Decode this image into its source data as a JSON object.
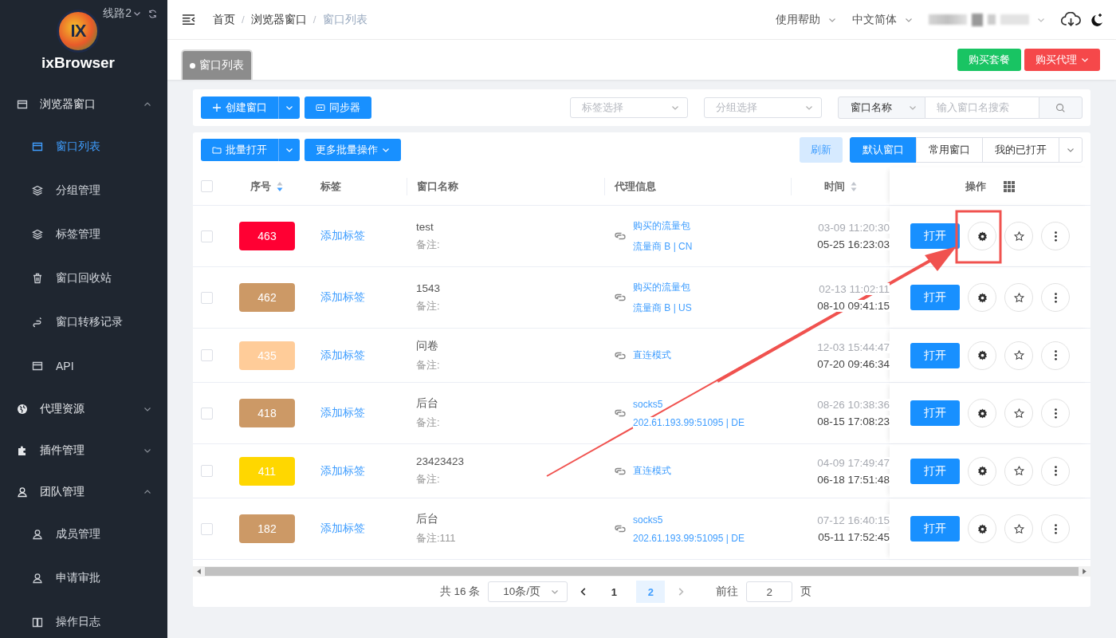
{
  "sidebar": {
    "route": "线路2",
    "logo_mark": "IX",
    "brand": "ixBrowser",
    "menu": [
      {
        "label": "浏览器窗口",
        "expanded": true,
        "children": [
          {
            "label": "窗口列表",
            "selected": true
          },
          {
            "label": "分组管理",
            "selected": false
          },
          {
            "label": "标签管理",
            "selected": false
          },
          {
            "label": "窗口回收站",
            "selected": false
          },
          {
            "label": "窗口转移记录",
            "selected": false
          },
          {
            "label": "API",
            "selected": false
          }
        ]
      },
      {
        "label": "代理资源",
        "expanded": false
      },
      {
        "label": "插件管理",
        "expanded": false
      },
      {
        "label": "团队管理",
        "expanded": true,
        "children": [
          {
            "label": "成员管理",
            "selected": false
          },
          {
            "label": "申请审批",
            "selected": false
          },
          {
            "label": "操作日志",
            "selected": false
          }
        ]
      }
    ]
  },
  "header": {
    "breadcrumb": [
      "首页",
      "浏览器窗口",
      "窗口列表"
    ],
    "separator": "/",
    "help": "使用帮助",
    "language": "中文简体"
  },
  "page_tabs": [
    {
      "label": "窗口列表",
      "selected": true
    }
  ],
  "top_buttons": {
    "buy_plan": "购买套餐",
    "buy_proxy": "购买代理"
  },
  "toolbar": {
    "create": "创建窗口",
    "sync": "同步器",
    "tag_select": {
      "placeholder": "标签选择"
    },
    "group_select": {
      "placeholder": "分组选择"
    },
    "search_type": "窗口名称",
    "search": {
      "placeholder": "输入窗口名搜索"
    }
  },
  "toolbar2": {
    "batch_open": "批量打开",
    "more_batch": "更多批量操作",
    "refresh": "刷新",
    "views": [
      {
        "label": "默认窗口",
        "selected": true
      },
      {
        "label": "常用窗口",
        "selected": false
      },
      {
        "label": "我的已打开",
        "selected": false
      }
    ]
  },
  "table": {
    "select_all": {
      "checked": false
    },
    "columns": [
      {
        "label": "序号",
        "kind": "sorted"
      },
      {
        "label": "标签",
        "kind": "plain"
      },
      {
        "label": "窗口名称",
        "kind": "plain"
      },
      {
        "label": "代理信息",
        "kind": "plain"
      },
      {
        "label": "时间",
        "kind": "sortable"
      },
      {
        "label": "操作",
        "kind": "actions"
      }
    ],
    "rows": [
      {
        "checked": false,
        "id": "463",
        "color": "#ff0033",
        "tag": "添加标签",
        "name": "test",
        "note": "备注:",
        "proxy": "购买的流量包",
        "proxy_detail": "流量商 B  | CN",
        "time_1": "03-09 11:20:30",
        "time_2": "05-25 16:23:03",
        "action": "打开"
      },
      {
        "checked": false,
        "id": "462",
        "color": "#cc9966",
        "tag": "添加标签",
        "name": "1543",
        "note": "备注:",
        "proxy": "购买的流量包",
        "proxy_detail": "流量商 B  | US",
        "time_1": "02-13 11:02:11",
        "time_2": "08-10 09:41:15",
        "action": "打开"
      },
      {
        "checked": false,
        "id": "435",
        "color": "#ffcc99",
        "tag": "添加标签",
        "name": "问卷",
        "note": "备注:",
        "proxy": "直连模式",
        "time_1": "12-03 15:44:47",
        "time_2": "07-20 09:46:34",
        "action": "打开"
      },
      {
        "checked": false,
        "id": "418",
        "color": "#cc9966",
        "tag": "添加标签",
        "name": "后台",
        "note": "备注:",
        "proxy": "socks5",
        "proxy_detail": "202.61.193.99:51095  | DE",
        "time_1": "08-26 10:38:36",
        "time_2": "08-15 17:08:23",
        "action": "打开"
      },
      {
        "checked": false,
        "id": "411",
        "color": "#ffd700",
        "tag": "添加标签",
        "name": "23423423",
        "note": "备注:",
        "proxy": "直连模式",
        "time_1": "04-09 17:49:47",
        "time_2": "06-18 17:51:48",
        "action": "打开"
      },
      {
        "checked": false,
        "id": "182",
        "color": "#cc9966",
        "tag": "添加标签",
        "name": "后台",
        "note": "备注:111",
        "proxy": "socks5",
        "proxy_detail": "202.61.193.99:51095  | DE",
        "time_1": "07-12 16:40:15",
        "time_2": "05-11 17:52:45",
        "action": "打开"
      }
    ]
  },
  "pagination": {
    "total": "共 16 条",
    "page_size": "10条/页",
    "pages": [
      {
        "label": "1",
        "selected": false
      },
      {
        "label": "2",
        "selected": true
      }
    ],
    "goto_label": "前往",
    "goto_value": "2",
    "goto_unit": "页"
  }
}
